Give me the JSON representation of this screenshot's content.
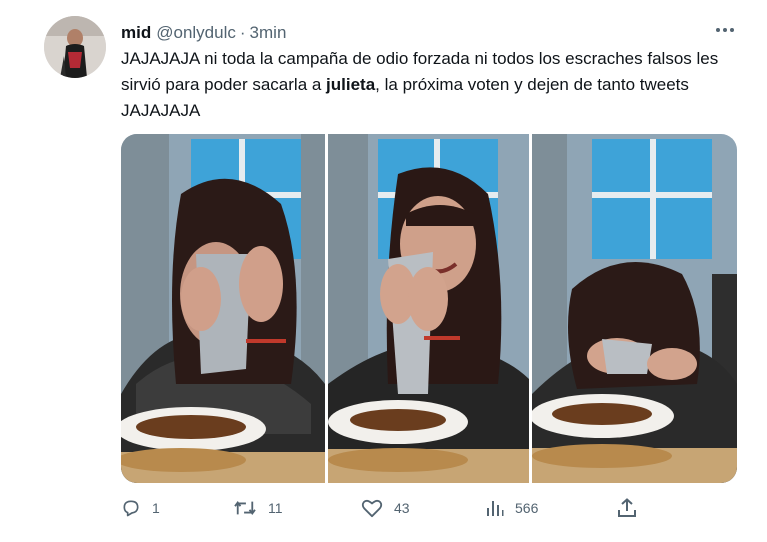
{
  "tweet": {
    "display_name": "mid",
    "handle": "@onlydulc",
    "separator": "·",
    "time": "3min",
    "text_before": "JAJAJAJA ni toda la campaña de odio forzada ni todos los escraches falsos les sirvió para poder sacarla a ",
    "text_bold": "julieta",
    "text_after": ", la próxima voten y dejen de tanto tweets JAJAJAJA"
  },
  "metrics": {
    "replies": "1",
    "retweets": "11",
    "likes": "43",
    "views": "566"
  },
  "icons": {
    "more": "more-icon",
    "reply": "reply-icon",
    "retweet": "retweet-icon",
    "like": "heart-icon",
    "views": "views-icon",
    "share": "share-icon"
  },
  "colors": {
    "text": "#0f1419",
    "secondary": "#536471"
  }
}
